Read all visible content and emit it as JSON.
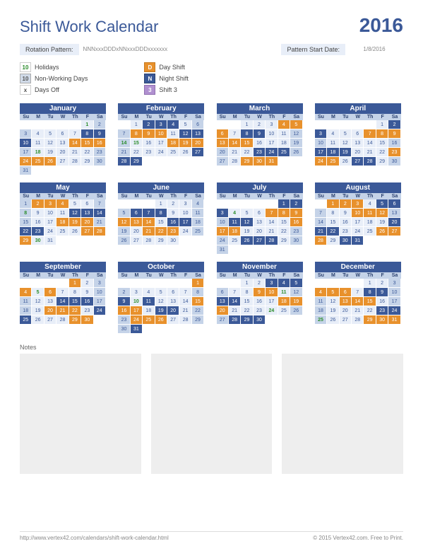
{
  "title": "Shift Work Calendar",
  "year": "2016",
  "rotation_label": "Rotation Pattern:",
  "rotation_value": "NNNxxxDDDxNNxxxDDDxxxxxxx",
  "start_label": "Pattern Start Date:",
  "start_value": "1/8/2016",
  "legend": {
    "holidays_key": "10",
    "holidays": "Holidays",
    "non_key": "10",
    "non": "Non-Working Days",
    "off_key": "x",
    "off": "Days Off",
    "day_key": "D",
    "day": "Day Shift",
    "night_key": "N",
    "night": "Night Shift",
    "s3_key": "3",
    "s3": "Shift 3"
  },
  "dow": [
    "Su",
    "M",
    "Tu",
    "W",
    "Th",
    "F",
    "Sa"
  ],
  "notes_label": "Notes",
  "footer_left": "http://www.vertex42.com/calendars/shift-work-calendar.html",
  "footer_right": "© 2015 Vertex42.com. Free to Print.",
  "months": [
    {
      "name": "January",
      "start": 5,
      "len": 31,
      "shifts": {
        "1": "h",
        "8": "n",
        "9": "n",
        "10": "n",
        "14": "d",
        "15": "d",
        "16": "d",
        "18": "h",
        "24": "d",
        "25": "d",
        "26": "d"
      }
    },
    {
      "name": "February",
      "start": 1,
      "len": 29,
      "shifts": {
        "2": "n",
        "3": "n",
        "4": "n",
        "8": "d",
        "9": "d",
        "10": "d",
        "12": "n",
        "13": "n",
        "14": "h",
        "15": "h",
        "18": "d",
        "19": "d",
        "20": "d",
        "27": "n",
        "28": "n",
        "29": "n"
      }
    },
    {
      "name": "March",
      "start": 2,
      "len": 31,
      "shifts": {
        "4": "d",
        "5": "d",
        "6": "d",
        "8": "n",
        "9": "n",
        "13": "d",
        "14": "d",
        "15": "d",
        "23": "n",
        "24": "n",
        "25": "n",
        "29": "d",
        "30": "d",
        "31": "d"
      }
    },
    {
      "name": "April",
      "start": 5,
      "len": 30,
      "shifts": {
        "2": "n",
        "3": "n",
        "7": "d",
        "8": "d",
        "9": "d",
        "17": "n",
        "18": "n",
        "19": "n",
        "23": "d",
        "24": "d",
        "25": "d",
        "27": "n",
        "28": "n"
      }
    },
    {
      "name": "May",
      "start": 0,
      "len": 31,
      "shifts": {
        "2": "d",
        "3": "d",
        "4": "d",
        "8": "h",
        "12": "n",
        "13": "n",
        "14": "n",
        "18": "d",
        "19": "d",
        "20": "d",
        "22": "n",
        "23": "n",
        "27": "d",
        "28": "d",
        "29": "d",
        "30": "h"
      }
    },
    {
      "name": "June",
      "start": 3,
      "len": 30,
      "shifts": {
        "6": "n",
        "7": "n",
        "8": "n",
        "12": "d",
        "13": "d",
        "14": "d",
        "16": "n",
        "17": "n",
        "21": "d",
        "22": "d",
        "23": "d"
      }
    },
    {
      "name": "July",
      "start": 5,
      "len": 31,
      "shifts": {
        "1": "n",
        "2": "n",
        "3": "n",
        "4": "h",
        "7": "d",
        "8": "d",
        "9": "d",
        "11": "n",
        "12": "n",
        "16": "d",
        "17": "d",
        "18": "d",
        "26": "n",
        "27": "n",
        "28": "n"
      }
    },
    {
      "name": "August",
      "start": 1,
      "len": 31,
      "shifts": {
        "1": "d",
        "2": "d",
        "3": "d",
        "5": "n",
        "6": "n",
        "10": "d",
        "11": "d",
        "12": "d",
        "20": "n",
        "21": "n",
        "22": "n",
        "26": "d",
        "27": "d",
        "28": "d",
        "30": "n",
        "31": "n"
      }
    },
    {
      "name": "September",
      "start": 4,
      "len": 30,
      "shifts": {
        "1": "d",
        "4": "d",
        "5": "h",
        "6": "d",
        "14": "n",
        "15": "n",
        "16": "n",
        "20": "d",
        "21": "d",
        "22": "d",
        "24": "n",
        "25": "n",
        "29": "d",
        "30": "d"
      }
    },
    {
      "name": "October",
      "start": 6,
      "len": 31,
      "shifts": {
        "1": "d",
        "9": "n",
        "10": "h",
        "11": "n",
        "15": "d",
        "16": "d",
        "17": "d",
        "19": "n",
        "20": "n",
        "24": "d",
        "25": "d",
        "26": "d",
        "31": "n"
      }
    },
    {
      "name": "November",
      "start": 2,
      "len": 30,
      "shifts": {
        "3": "n",
        "4": "n",
        "5": "n",
        "9": "d",
        "10": "d",
        "11": "h",
        "13": "n",
        "14": "n",
        "18": "d",
        "19": "d",
        "20": "d",
        "24": "h",
        "28": "n",
        "29": "n",
        "30": "n"
      }
    },
    {
      "name": "December",
      "start": 4,
      "len": 31,
      "shifts": {
        "4": "d",
        "5": "d",
        "6": "d",
        "8": "n",
        "9": "n",
        "13": "d",
        "14": "d",
        "15": "d",
        "23": "n",
        "24": "n",
        "25": "h",
        "29": "d",
        "30": "d",
        "31": "d"
      }
    }
  ]
}
